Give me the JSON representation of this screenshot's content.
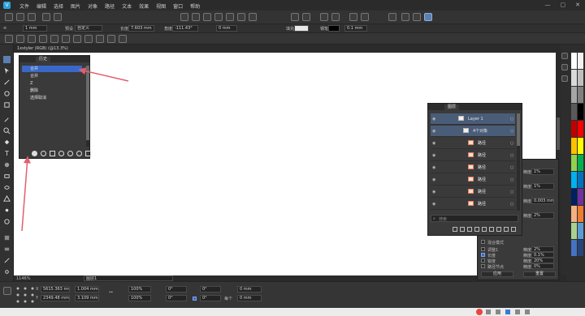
{
  "app": {
    "menu": [
      "文件",
      "编辑",
      "选择",
      "图片",
      "对象",
      "路径",
      "文本",
      "效果",
      "视图",
      "窗口",
      "帮助"
    ]
  },
  "context_bar": {
    "stroke_width": "1 mm",
    "preset_label": "预设",
    "preset_value": "自定义",
    "length_label": "长度",
    "length_value": "7.603 mm",
    "angle_label": "角度",
    "angle_value": "-111.43°",
    "offset_value": "0 mm",
    "fill_label": "填充",
    "pen_label": "钢笔",
    "pen_value": "0.1 mm"
  },
  "document": {
    "tab_title": "1xstyler (RGB) (@13.3%)",
    "zoom": "1146%",
    "status_field": "图层1"
  },
  "history_panel": {
    "tab": "历史",
    "items": [
      {
        "label": "合并",
        "selected": true
      },
      {
        "label": "合并",
        "selected": false
      },
      {
        "label": "Z",
        "selected": false
      },
      {
        "label": "删除",
        "selected": false
      },
      {
        "label": "选择取消",
        "selected": false
      }
    ]
  },
  "objects_panel": {
    "tab": "图层",
    "search_placeholder": "搜索",
    "rows": [
      {
        "label": "Layer 1",
        "kind": "layer"
      },
      {
        "label": "4个对象",
        "kind": "group"
      },
      {
        "label": "路径",
        "kind": "path"
      },
      {
        "label": "路径",
        "kind": "path"
      },
      {
        "label": "路径",
        "kind": "path"
      },
      {
        "label": "路径",
        "kind": "path"
      },
      {
        "label": "路径",
        "kind": "path"
      },
      {
        "label": "路径",
        "kind": "path"
      }
    ]
  },
  "options_panel": {
    "fields": [
      {
        "label": "精度",
        "value": "1%"
      },
      {
        "label": "精度",
        "value": "1%"
      },
      {
        "label": "精度",
        "value": "0.003 mm"
      },
      {
        "label": "精度",
        "value": "2%"
      }
    ],
    "section": "混合模式",
    "checks": [
      {
        "label": "调整1",
        "checked": false,
        "value_label": "精度",
        "value": "2%"
      },
      {
        "label": "长度",
        "checked": true,
        "value_label": "精度",
        "value": "0.1%"
      },
      {
        "label": "锐度",
        "checked": false,
        "value_label": "精度",
        "value": "20%"
      },
      {
        "label": "路径节点",
        "checked": false,
        "value_label": "精度",
        "value": "0%"
      }
    ],
    "apply": "应用",
    "reset": "重置"
  },
  "transform_bar": {
    "x": "5615.363 mm",
    "y": "2349.48 mm",
    "w": "1.004 mm",
    "h": "3.109 mm",
    "scale_x": "100%",
    "scale_y": "100%",
    "rot_a": "0°",
    "rot_b": "0°",
    "skew_a": "0°",
    "skew_b": "0°",
    "pos_a": "0 mm",
    "pos_b": "0 mm",
    "each_label": "每个"
  },
  "colors": {
    "accent": "#3a68c8",
    "arrow": "#e06070",
    "palette": [
      "#ffffff",
      "#f2f2f2",
      "#d9d9d9",
      "#bfbfbf",
      "#a6a6a6",
      "#808080",
      "#595959",
      "#000000",
      "#c00000",
      "#ff0000",
      "#ffc000",
      "#ffff00",
      "#92d050",
      "#00b050",
      "#00b0f0",
      "#0070c0",
      "#002060",
      "#7030a0",
      "#f4b183",
      "#ed7d31",
      "#a9d18e",
      "#5b9bd5",
      "#4472c4",
      "#264478"
    ]
  }
}
